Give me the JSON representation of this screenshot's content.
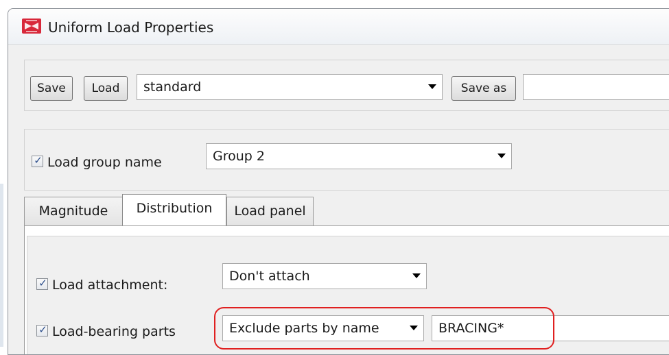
{
  "window": {
    "title": "Uniform Load Properties"
  },
  "toolbar": {
    "save_label": "Save",
    "load_label": "Load",
    "preset_value": "standard",
    "save_as_label": "Save as",
    "save_as_value": ""
  },
  "load_group": {
    "label": "Load group name",
    "checked": true,
    "value": "Group 2"
  },
  "tabs": [
    {
      "label": "Magnitude",
      "active": false
    },
    {
      "label": "Distribution",
      "active": true
    },
    {
      "label": "Load panel",
      "active": false
    }
  ],
  "distribution": {
    "load_attachment": {
      "label": "Load attachment:",
      "checked": true,
      "value": "Don't attach"
    },
    "load_bearing_parts": {
      "label": "Load-bearing parts",
      "checked": true,
      "mode_value": "Exclude parts by name",
      "name_value": "BRACING*"
    }
  },
  "icons": {
    "app": "tekla-app-icon",
    "check": "checkmark-icon",
    "dropdown": "chevron-down-icon"
  },
  "colors": {
    "highlight": "#e02020",
    "check": "#2a4c8a"
  }
}
